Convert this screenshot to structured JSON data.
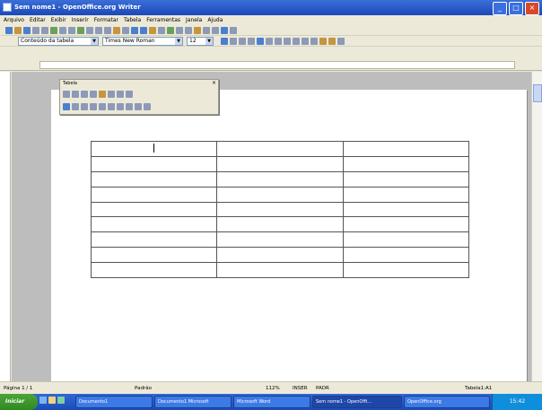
{
  "window": {
    "title": "Sem nome1 - OpenOffice.org Writer"
  },
  "window_buttons": {
    "minimize": "_",
    "maximize": "□",
    "close": "×"
  },
  "menu": [
    "Arquivo",
    "Editar",
    "Exibir",
    "Inserir",
    "Formatar",
    "Tabela",
    "Ferramentas",
    "Janela",
    "Ajuda"
  ],
  "format_bar": {
    "paragraph_style": "Conteúdo da tabela",
    "font_name": "Times New Roman",
    "font_size": "12"
  },
  "floating_toolbar": {
    "title": "Tabela"
  },
  "table": {
    "rows": 9,
    "cols": 3
  },
  "status": {
    "page": "Página 1 / 1",
    "style": "Padrão",
    "zoom": "112%",
    "mode1": "INSER",
    "mode2": "PADR",
    "table_ref": "Tabela1:A1"
  },
  "taskbar": {
    "start": "Iniciar",
    "tasks": [
      "Documento1",
      "Documento1 Microsoft",
      "Microsoft Word",
      "Sem nome1 - OpenOffi...",
      "OpenOffice.org"
    ],
    "clock": "15:42"
  }
}
